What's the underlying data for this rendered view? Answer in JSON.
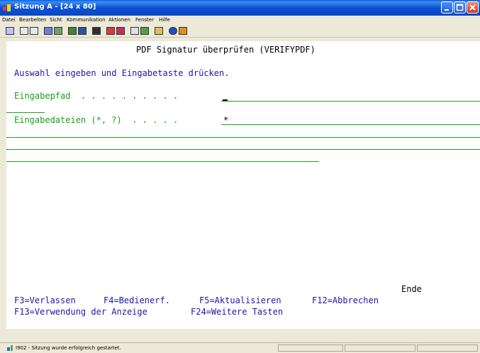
{
  "window": {
    "title": "Sitzung A - [24 x 80]"
  },
  "menu": [
    "Datei",
    "Bearbeiten",
    "Sicht",
    "Kommunikation",
    "Aktionen",
    "Fenster",
    "Hilfe"
  ],
  "screen": {
    "header": "PDF Signatur überprüfen (VERIFYPDF)",
    "instruction": "Auswahl eingeben und Eingabetaste drücken.",
    "fields": [
      {
        "label": "Eingabepfad  . . . . . . . . . .",
        "value": ""
      },
      {
        "label": "Eingabedateien (*, ?)  . . . . .",
        "value": "*"
      }
    ],
    "end_label": "Ende",
    "fkeys_line1": [
      "F3=Verlassen",
      "F4=Bedienerf.",
      "F5=Aktualisieren",
      "F12=Abbrechen"
    ],
    "fkeys_line2": [
      "F13=Verwendung der Anzeige",
      "F24=Weitere Tasten"
    ]
  },
  "status": {
    "text": "I902 - Sitzung wurde erfolgreich gestartet."
  },
  "colors": {
    "titlebar": "#0a52d0",
    "field_label": "#17a117",
    "instruction": "#1a1aa8"
  }
}
